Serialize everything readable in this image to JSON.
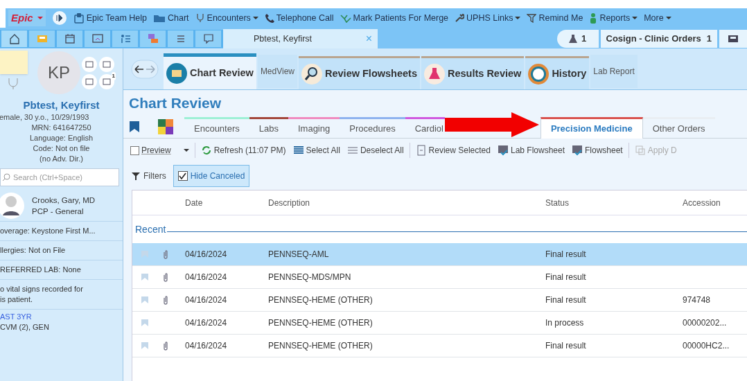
{
  "menu_bar": {
    "app_button": {
      "label": "Epic",
      "has_menu": true
    },
    "items": [
      {
        "label": "Epic Team Help",
        "has_menu": false
      },
      {
        "label": "Chart",
        "has_menu": false
      },
      {
        "label": "Encounters",
        "has_menu": true
      },
      {
        "label": "Telephone Call",
        "has_menu": false
      },
      {
        "label": "Mark Patients For Merge",
        "has_menu": false
      },
      {
        "label": "UPHS Links",
        "has_menu": true
      },
      {
        "label": "Remind Me",
        "has_menu": false
      },
      {
        "label": "Reports",
        "has_menu": true
      },
      {
        "label": "More",
        "has_menu": true
      }
    ]
  },
  "workspace_bar": {
    "patient_tab": {
      "label": "Pbtest, Keyfirst",
      "close": "×"
    },
    "lab_count": "1",
    "cosign": {
      "label": "Cosign - Clinic Orders",
      "count": "1"
    }
  },
  "patient": {
    "initials": "KP",
    "badge": "1",
    "name": "Pbtest, Keyfirst",
    "details": [
      "emale, 30 y.o., 10/29/1993",
      "MRN: 641647250",
      "Language: English",
      "Code: Not on file",
      "(no Adv. Dir.)"
    ],
    "search": {
      "placeholder": "Search (Ctrl+Space)"
    },
    "pcp": {
      "name": "Crooks, Gary, MD",
      "role": "PCP - General"
    },
    "sections": [
      "overage: Keystone First M...",
      "llergies: Not on File",
      "REFERRED LAB: None",
      "o vital signs recorded for\nis patient."
    ],
    "past": {
      "heading": "AST 3YR",
      "lines": [
        "CVM (2), GEN"
      ]
    }
  },
  "activity_tabs": [
    {
      "label": "Chart Review",
      "kind": "major",
      "selected": true
    },
    {
      "label": "MedView",
      "kind": "minor",
      "selected": false
    },
    {
      "label": "Review Flowsheets",
      "kind": "major",
      "selected": false
    },
    {
      "label": "Results Review",
      "kind": "major",
      "selected": false
    },
    {
      "label": "History",
      "kind": "major",
      "selected": false
    },
    {
      "label": "Lab Report",
      "kind": "minor",
      "selected": false
    }
  ],
  "chart_review": {
    "title": "Chart Review",
    "tabs": [
      {
        "label": "Encounters",
        "color": "#9ef0d6",
        "selected": false
      },
      {
        "label": "Labs",
        "color": "#a4473c",
        "selected": false
      },
      {
        "label": "Imaging",
        "color": "#f08cc0",
        "selected": false
      },
      {
        "label": "Procedures",
        "color": "#8fb3ef",
        "selected": false
      },
      {
        "label": "Cardiol",
        "color": "#d05ae0",
        "selected": false
      },
      {
        "label": "Precision Medicine",
        "color": "#d9534f",
        "selected": true
      },
      {
        "label": "Other Orders",
        "color": "#e9eef3",
        "selected": false
      }
    ],
    "toolbar": [
      {
        "label": "Preview",
        "kind": "checkbox",
        "checked": false
      },
      {
        "label": "Refresh (11:07 PM)",
        "kind": "refresh"
      },
      {
        "label": "Select All",
        "kind": "selectall"
      },
      {
        "label": "Deselect All",
        "kind": "deselect"
      },
      {
        "label": "Review Selected",
        "kind": "review"
      },
      {
        "label": "Lab Flowsheet",
        "kind": "flowsheet"
      },
      {
        "label": "Flowsheet",
        "kind": "flowsheet"
      },
      {
        "label": "Apply D",
        "kind": "apply",
        "disabled": true
      }
    ],
    "filters": {
      "label": "Filters"
    },
    "hide_canceled": {
      "label": "Hide Canceled",
      "checked": true
    },
    "columns": [
      "Date",
      "Description",
      "Status",
      "Accession"
    ],
    "group": "Recent",
    "rows": [
      {
        "date": "04/16/2024",
        "description": "PENNSEQ-AML",
        "status": "Final result",
        "accession": "",
        "attachment": true,
        "selected": true
      },
      {
        "date": "04/16/2024",
        "description": "PENNSEQ-MDS/MPN",
        "status": "Final result",
        "accession": "",
        "attachment": true,
        "selected": false
      },
      {
        "date": "04/16/2024",
        "description": "PENNSEQ-HEME (OTHER)",
        "status": "Final result",
        "accession": "974748",
        "attachment": true,
        "selected": false
      },
      {
        "date": "04/16/2024",
        "description": "PENNSEQ-HEME (OTHER)",
        "status": "In process",
        "accession": "00000202...",
        "attachment": false,
        "selected": false
      },
      {
        "date": "04/16/2024",
        "description": "PENNSEQ-HEME (OTHER)",
        "status": "Final result",
        "accession": "00000HC2...",
        "attachment": true,
        "selected": false
      }
    ]
  }
}
